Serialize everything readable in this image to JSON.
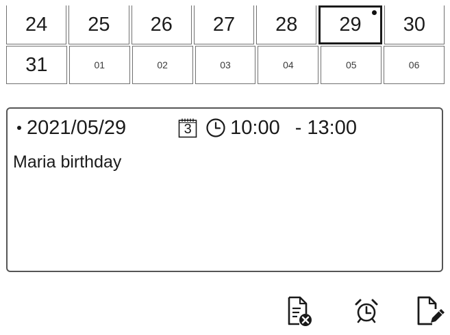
{
  "calendar": {
    "row1": [
      "24",
      "25",
      "26",
      "27",
      "28",
      "29",
      "30"
    ],
    "row2": [
      "31",
      "01",
      "02",
      "03",
      "04",
      "05",
      "06"
    ],
    "selected_day": "29"
  },
  "event": {
    "date": "2021/05/29",
    "calendar_badge": "3",
    "time_start": "10:00",
    "time_separator": "-",
    "time_end": "13:00",
    "title": "Maria birthday"
  },
  "icons": {
    "delete": "delete-document-icon",
    "alarm": "alarm-clock-icon",
    "edit": "edit-document-icon"
  },
  "colors": {
    "ink": "#1a1a1a",
    "border": "#6f6f6f"
  }
}
